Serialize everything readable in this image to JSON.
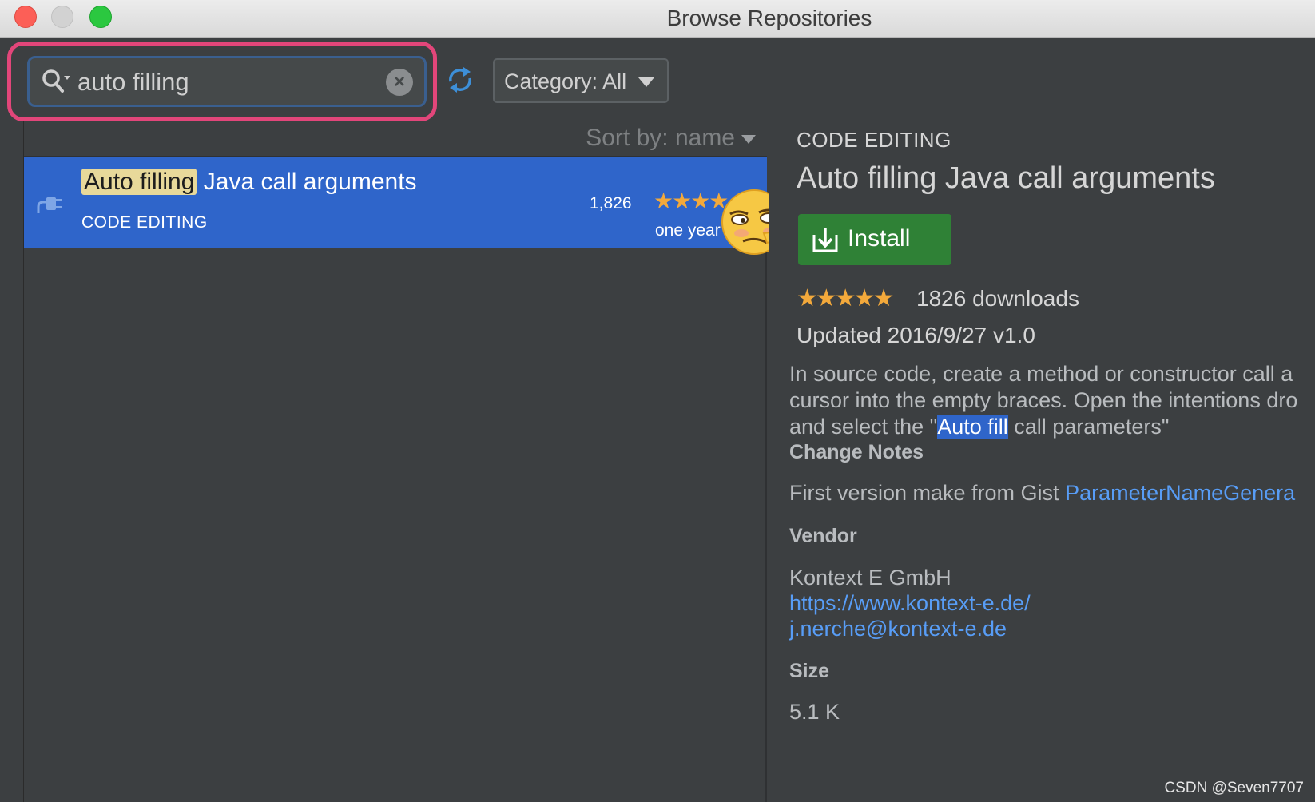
{
  "window": {
    "title": "Browse Repositories"
  },
  "search": {
    "value": "auto filling"
  },
  "category": {
    "label": "Category: All"
  },
  "sort": {
    "label": "Sort by: name"
  },
  "list": {
    "items": [
      {
        "title_match": "Auto filling",
        "title_rest": " Java call arguments",
        "category": "CODE EDITING",
        "downloads": "1,826",
        "rating_stars": "★★★★",
        "updated": "one year"
      }
    ]
  },
  "detail": {
    "category": "CODE EDITING",
    "title": "Auto filling Java call arguments",
    "install_label": "Install",
    "stars": "★★★★★",
    "downloads": "1826 downloads",
    "updated": "Updated 2016/9/27   v1.0",
    "description": {
      "line1": "In source code, create a method or constructor call a",
      "line2": "cursor into the empty braces. Open the intentions dro",
      "line3_pre": "and select the \"",
      "line3_sel": "Auto fill",
      "line3_post": " call parameters\""
    },
    "change_notes_heading": "Change Notes",
    "change_notes_text": "First version make from Gist ",
    "change_notes_link": "ParameterNameGenera",
    "vendor_heading": "Vendor",
    "vendor_name": "Kontext E GmbH",
    "vendor_url": "https://www.kontext-e.de/",
    "vendor_email": "j.nerche@kontext-e.de",
    "size_heading": "Size",
    "size_value": "5.1 K"
  },
  "watermark": "CSDN @Seven7707",
  "colors": {
    "accent": "#2f65ca",
    "highlight": "#e2467a",
    "install": "#2f8136",
    "star": "#f3a93b",
    "link": "#589df6"
  }
}
